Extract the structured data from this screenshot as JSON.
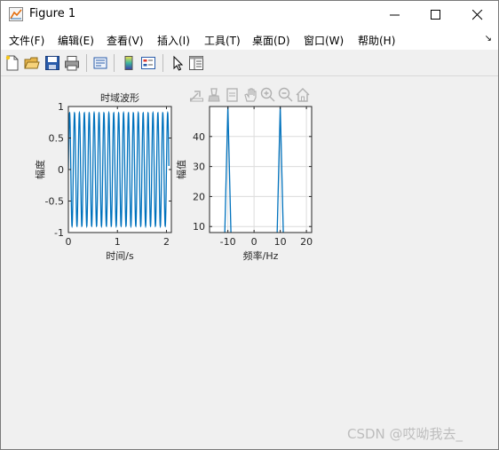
{
  "window": {
    "title": "Figure 1",
    "icon": "matlab-figure-icon"
  },
  "menu": {
    "items": [
      "文件(F)",
      "编辑(E)",
      "查看(V)",
      "插入(I)",
      "工具(T)",
      "桌面(D)",
      "窗口(W)",
      "帮助(H)"
    ]
  },
  "toolbar": {
    "icons": [
      "new-figure-icon",
      "open-file-icon",
      "save-icon",
      "print-icon",
      "link-plot-icon",
      "insert-colorbar-icon",
      "insert-legend-icon",
      "edit-plot-pointer-icon",
      "property-inspector-icon"
    ]
  },
  "axes_toolbar": {
    "icons": [
      "export-icon",
      "brush-icon",
      "data-tips-icon",
      "pan-hand-icon",
      "zoom-in-icon",
      "zoom-out-icon",
      "home-icon"
    ]
  },
  "chart_data": [
    {
      "type": "line",
      "title": "时域波形",
      "xlabel": "时间/s",
      "ylabel": "幅度",
      "xlim": [
        0,
        2.1
      ],
      "ylim": [
        -1,
        1
      ],
      "xticks": [
        "0",
        "1",
        "2"
      ],
      "yticks": [
        "-1",
        "-0.5",
        "0",
        "0.5",
        "1"
      ],
      "signal": "sinusoid, frequency 10 Hz, amplitude 1",
      "frequency_hz": 10,
      "amplitude": 0.9,
      "color": "#0072bd",
      "grid": false
    },
    {
      "type": "line",
      "title": "",
      "xlabel": "频率/Hz",
      "ylabel": "幅值",
      "xlim": [
        -17,
        22
      ],
      "ylim": [
        8,
        50
      ],
      "xticks": [
        "-10",
        "0",
        "10",
        "20"
      ],
      "yticks": [
        "10",
        "20",
        "30",
        "40"
      ],
      "peaks": [
        {
          "x": -10,
          "y": 50
        },
        {
          "x": 10,
          "y": 50
        }
      ],
      "color": "#0072bd",
      "grid": true
    }
  ],
  "watermark": "CSDN @哎呦我去_"
}
